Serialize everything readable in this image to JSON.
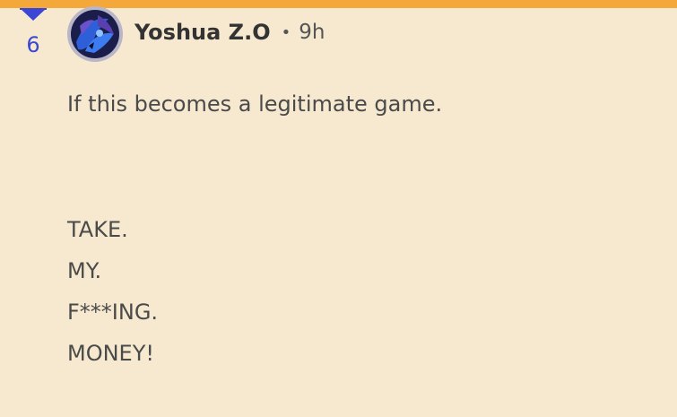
{
  "colors": {
    "background": "#f6e9cf",
    "top_bar": "#f5a83a",
    "vote_accent": "#3b45d6",
    "text": "#4a4a4a"
  },
  "comment": {
    "vote": {
      "icon": "downvote-arrow-icon",
      "score": "6"
    },
    "author": {
      "avatar_icon": "user-avatar",
      "username": "Yoshua Z.O",
      "separator": "•",
      "time": "9h"
    },
    "body": {
      "line1": "If this becomes a legitimate game.",
      "line2": "TAKE.",
      "line3": "MY.",
      "line4": "F***ING.",
      "line5": "MONEY!"
    }
  }
}
